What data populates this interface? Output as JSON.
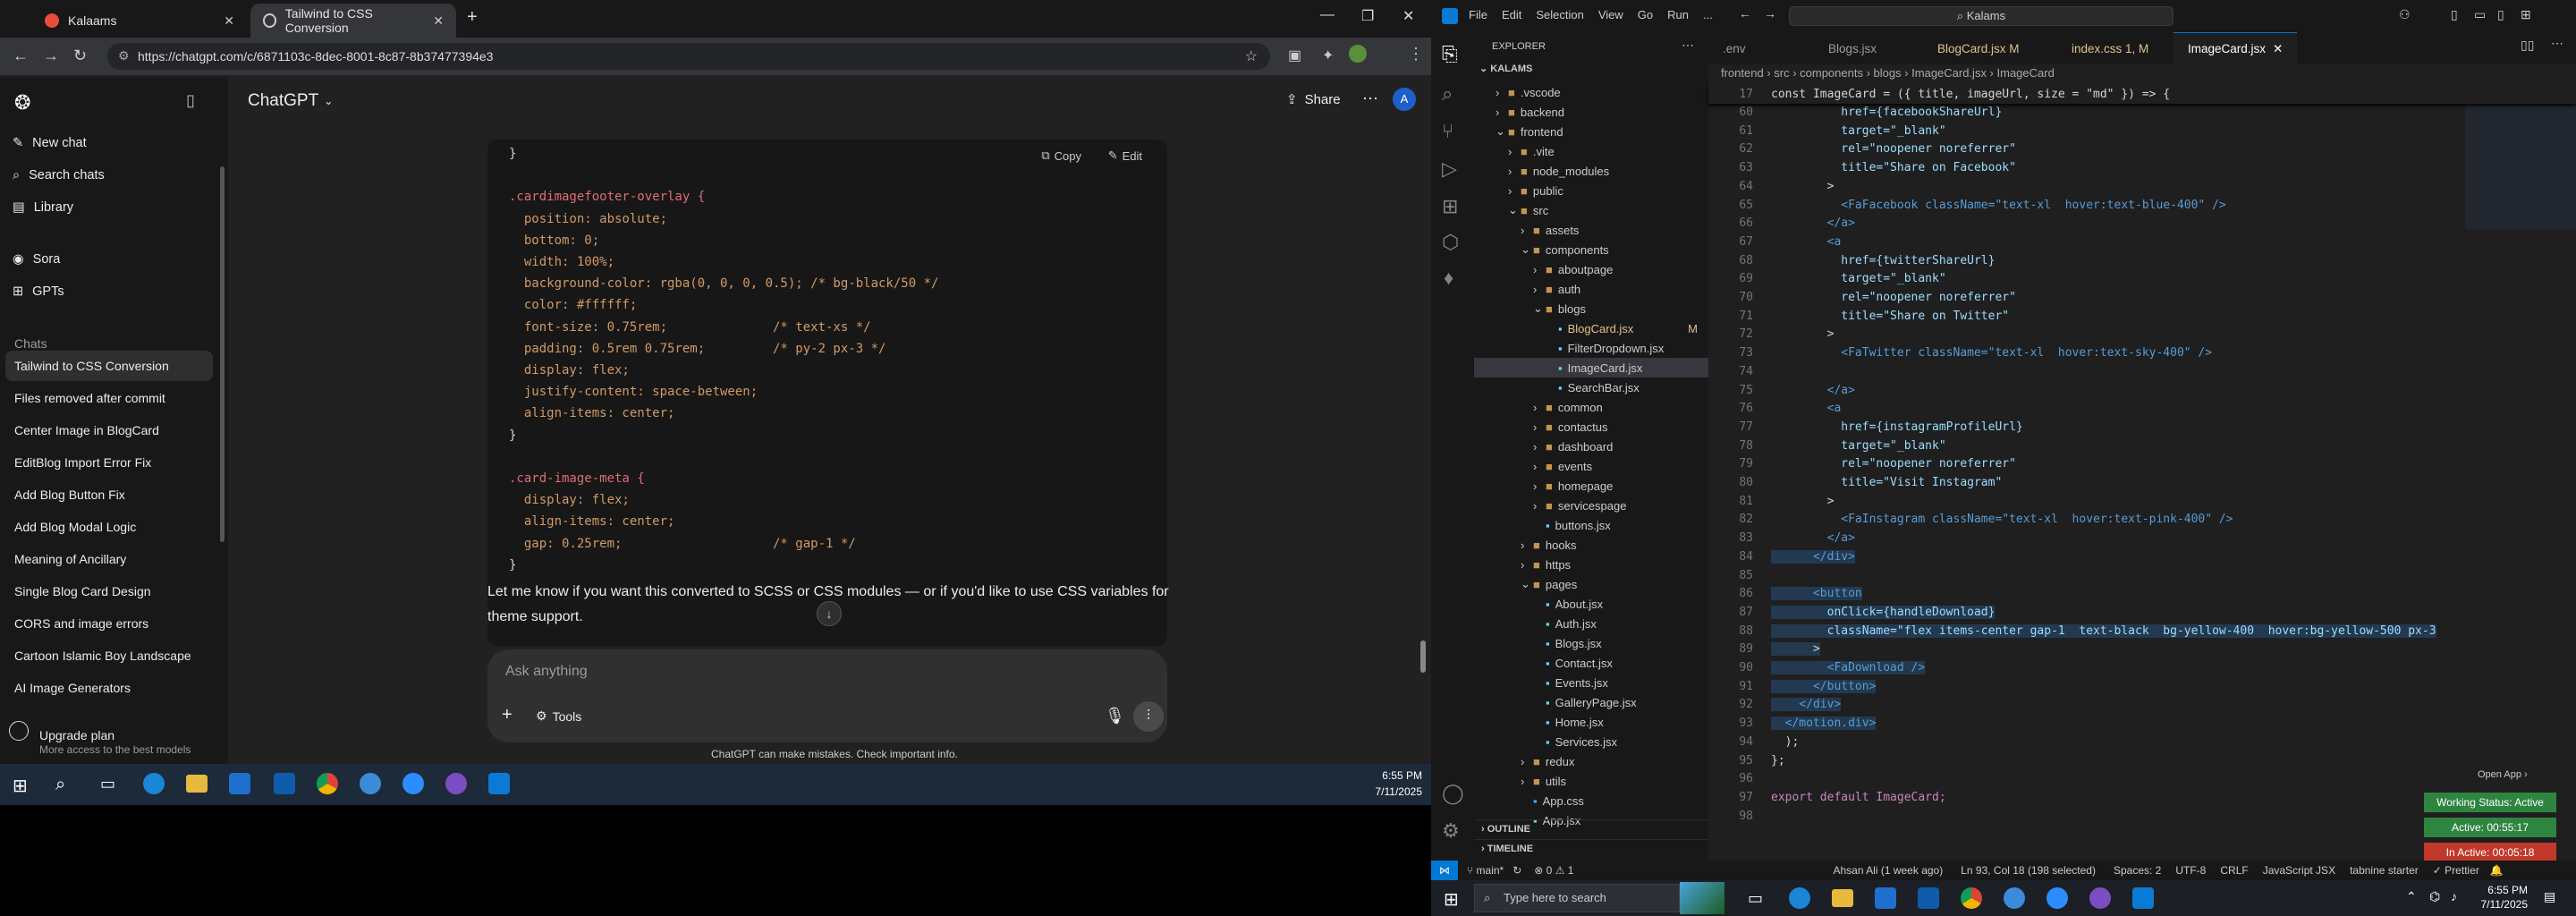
{
  "browser": {
    "tabs": [
      {
        "label": "Kalaams"
      },
      {
        "label": "Tailwind to CSS Conversion"
      }
    ],
    "new_tab": "+",
    "url": "https://chatgpt.com/c/6871103c-8dec-8001-8c87-8b37477394e3"
  },
  "chatgpt": {
    "model": "ChatGPT",
    "share": "Share",
    "nav": [
      {
        "label": "New chat",
        "icon": "edit-icon"
      },
      {
        "label": "Search chats",
        "icon": "search-icon"
      },
      {
        "label": "Library",
        "icon": "library-icon"
      },
      {
        "label": "Sora",
        "icon": "sora-icon"
      },
      {
        "label": "GPTs",
        "icon": "grid-icon"
      }
    ],
    "chats_heading": "Chats",
    "chats": [
      "Tailwind to CSS Conversion",
      "Files removed after commit",
      "Center Image in BlogCard",
      "EditBlog Import Error Fix",
      "Add Blog Button Fix",
      "Add Blog Modal Logic",
      "Meaning of Ancillary",
      "Single Blog Card Design",
      "CORS and image errors",
      "Cartoon Islamic Boy Landscape",
      "AI Image Generators"
    ],
    "upgrade": {
      "title": "Upgrade plan",
      "subtitle": "More access to the best models"
    },
    "code_actions": {
      "copy": "Copy",
      "edit": "Edit"
    },
    "code_lines": [
      "}",
      "",
      ".cardimagefooter-overlay {",
      "  position: absolute;",
      "  bottom: 0;",
      "  width: 100%;",
      "  background-color: rgba(0, 0, 0, 0.5); /* bg-black/50 */",
      "  color: #ffffff;",
      "  font-size: 0.75rem;              /* text-xs */",
      "  padding: 0.5rem 0.75rem;         /* py-2 px-3 */",
      "  display: flex;",
      "  justify-content: space-between;",
      "  align-items: center;",
      "}",
      "",
      ".card-image-meta {",
      "  display: flex;",
      "  align-items: center;",
      "  gap: 0.25rem;                    /* gap-1 */",
      "}"
    ],
    "response_text": "Let me know if you want this converted to SCSS or CSS modules — or if you'd like to use CSS variables for theme support.",
    "composer": {
      "placeholder": "Ask anything",
      "tools": "Tools"
    },
    "disclaimer": "ChatGPT can make mistakes. Check important info."
  },
  "taskbar_left": {
    "time": "6:55 PM",
    "date": "7/11/2025"
  },
  "vscode": {
    "menu": [
      "File",
      "Edit",
      "Selection",
      "View",
      "Go",
      "Run",
      "..."
    ],
    "search": "Kalams",
    "explorer_title": "EXPLORER",
    "root": "KALAMS",
    "tree": [
      {
        "label": ".vscode",
        "depth": 1,
        "kind": "folder"
      },
      {
        "label": "backend",
        "depth": 1,
        "kind": "folder"
      },
      {
        "label": "frontend",
        "depth": 1,
        "kind": "folder-open"
      },
      {
        "label": ".vite",
        "depth": 2,
        "kind": "folder"
      },
      {
        "label": "node_modules",
        "depth": 2,
        "kind": "folder"
      },
      {
        "label": "public",
        "depth": 2,
        "kind": "folder"
      },
      {
        "label": "src",
        "depth": 2,
        "kind": "folder-open"
      },
      {
        "label": "assets",
        "depth": 3,
        "kind": "folder"
      },
      {
        "label": "components",
        "depth": 3,
        "kind": "folder-open"
      },
      {
        "label": "aboutpage",
        "depth": 4,
        "kind": "folder"
      },
      {
        "label": "auth",
        "depth": 4,
        "kind": "folder"
      },
      {
        "label": "blogs",
        "depth": 4,
        "kind": "folder-open"
      },
      {
        "label": "BlogCard.jsx",
        "depth": 5,
        "kind": "file",
        "badge": "M"
      },
      {
        "label": "FilterDropdown.jsx",
        "depth": 5,
        "kind": "file"
      },
      {
        "label": "ImageCard.jsx",
        "depth": 5,
        "kind": "file",
        "selected": true
      },
      {
        "label": "SearchBar.jsx",
        "depth": 5,
        "kind": "file"
      },
      {
        "label": "common",
        "depth": 4,
        "kind": "folder"
      },
      {
        "label": "contactus",
        "depth": 4,
        "kind": "folder"
      },
      {
        "label": "dashboard",
        "depth": 4,
        "kind": "folder"
      },
      {
        "label": "events",
        "depth": 4,
        "kind": "folder"
      },
      {
        "label": "homepage",
        "depth": 4,
        "kind": "folder"
      },
      {
        "label": "servicespage",
        "depth": 4,
        "kind": "folder"
      },
      {
        "label": "buttons.jsx",
        "depth": 4,
        "kind": "file"
      },
      {
        "label": "hooks",
        "depth": 3,
        "kind": "folder"
      },
      {
        "label": "https",
        "depth": 3,
        "kind": "folder"
      },
      {
        "label": "pages",
        "depth": 3,
        "kind": "folder-open"
      },
      {
        "label": "About.jsx",
        "depth": 4,
        "kind": "file"
      },
      {
        "label": "Auth.jsx",
        "depth": 4,
        "kind": "file"
      },
      {
        "label": "Blogs.jsx",
        "depth": 4,
        "kind": "file"
      },
      {
        "label": "Contact.jsx",
        "depth": 4,
        "kind": "file"
      },
      {
        "label": "Events.jsx",
        "depth": 4,
        "kind": "file"
      },
      {
        "label": "GalleryPage.jsx",
        "depth": 4,
        "kind": "file"
      },
      {
        "label": "Home.jsx",
        "depth": 4,
        "kind": "file"
      },
      {
        "label": "Services.jsx",
        "depth": 4,
        "kind": "file"
      },
      {
        "label": "redux",
        "depth": 3,
        "kind": "folder"
      },
      {
        "label": "utils",
        "depth": 3,
        "kind": "folder"
      },
      {
        "label": "App.css",
        "depth": 3,
        "kind": "file"
      },
      {
        "label": "App.jsx",
        "depth": 3,
        "kind": "file"
      }
    ],
    "outline": "OUTLINE",
    "timeline": "TIMELINE",
    "tabs": [
      {
        "label": ".env"
      },
      {
        "label": "Blogs.jsx"
      },
      {
        "label": "BlogCard.jsx M"
      },
      {
        "label": "index.css 1, M"
      },
      {
        "label": "ImageCard.jsx",
        "active": true
      }
    ],
    "breadcrumb": "frontend › src › components › blogs › ImageCard.jsx › ImageCard",
    "sticky_line": {
      "num": "17",
      "text": "const ImageCard = ({ title, imageUrl, size = \"md\" }) => {"
    },
    "lines": [
      {
        "n": "60",
        "t": "          href={facebookShareUrl}"
      },
      {
        "n": "61",
        "t": "          target=\"_blank\""
      },
      {
        "n": "62",
        "t": "          rel=\"noopener noreferrer\""
      },
      {
        "n": "63",
        "t": "          title=\"Share on Facebook\""
      },
      {
        "n": "64",
        "t": "        >"
      },
      {
        "n": "65",
        "t": "          <FaFacebook className=\"text-xl  hover:text-blue-400\" />"
      },
      {
        "n": "66",
        "t": "        </a>"
      },
      {
        "n": "67",
        "t": "        <a"
      },
      {
        "n": "68",
        "t": "          href={twitterShareUrl}"
      },
      {
        "n": "69",
        "t": "          target=\"_blank\""
      },
      {
        "n": "70",
        "t": "          rel=\"noopener noreferrer\""
      },
      {
        "n": "71",
        "t": "          title=\"Share on Twitter\""
      },
      {
        "n": "72",
        "t": "        >"
      },
      {
        "n": "73",
        "t": "          <FaTwitter className=\"text-xl  hover:text-sky-400\" />"
      },
      {
        "n": "74",
        "t": ""
      },
      {
        "n": "75",
        "t": "        </a>"
      },
      {
        "n": "76",
        "t": "        <a"
      },
      {
        "n": "77",
        "t": "          href={instagramProfileUrl}"
      },
      {
        "n": "78",
        "t": "          target=\"_blank\""
      },
      {
        "n": "79",
        "t": "          rel=\"noopener noreferrer\""
      },
      {
        "n": "80",
        "t": "          title=\"Visit Instagram\""
      },
      {
        "n": "81",
        "t": "        >"
      },
      {
        "n": "82",
        "t": "          <FaInstagram className=\"text-xl  hover:text-pink-400\" />"
      },
      {
        "n": "83",
        "t": "        </a>"
      },
      {
        "n": "84",
        "t": "      </div>"
      },
      {
        "n": "85",
        "t": ""
      },
      {
        "n": "86",
        "t": "      <button"
      },
      {
        "n": "87",
        "t": "        onClick={handleDownload}"
      },
      {
        "n": "88",
        "t": "        className=\"flex items-center gap-1  text-black  bg-yellow-400  hover:bg-yellow-500 px-3"
      },
      {
        "n": "89",
        "t": "      >"
      },
      {
        "n": "90",
        "t": "        <FaDownload />"
      },
      {
        "n": "91",
        "t": "      </button>"
      },
      {
        "n": "92",
        "t": "    </div>"
      },
      {
        "n": "93",
        "t": "  </motion.div>"
      },
      {
        "n": "94",
        "t": "  );"
      },
      {
        "n": "95",
        "t": "};"
      },
      {
        "n": "96",
        "t": ""
      },
      {
        "n": "97",
        "t": "export default ImageCard;"
      },
      {
        "n": "98",
        "t": ""
      }
    ],
    "open_app": "Open App ›",
    "working_status": "Working Status: Active",
    "active_time": "Active: 00:55:17",
    "inactive_time": "In Active: 00:05:18",
    "status": {
      "branch": "main*",
      "problems": "⊗ 0 ⚠ 1",
      "author": "Ahsan Ali (1 week ago)",
      "position": "Ln 93, Col 18 (198 selected)",
      "spaces": "Spaces: 2",
      "encoding": "UTF-8",
      "eol": "CRLF",
      "language": "JavaScript JSX",
      "tabnine": "tabnine starter",
      "prettier": "✓ Prettier"
    }
  },
  "win_taskbar": {
    "search": "Type here to search",
    "time": "6:55 PM",
    "date": "7/11/2025"
  }
}
